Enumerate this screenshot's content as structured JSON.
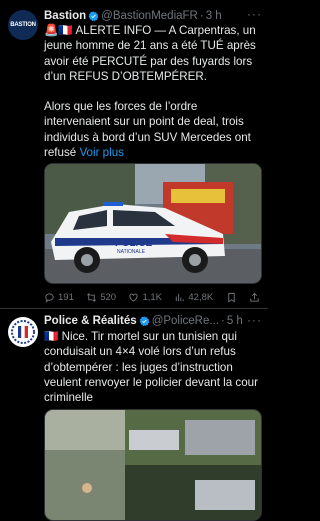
{
  "tweets": [
    {
      "name": "Bastion",
      "handle": "@BastionMediaFR",
      "sep": "·",
      "time": "3 h",
      "avatar_text": "BASTION",
      "headline": "🚨🇫🇷 ALERTE INFO — A Carpentras, un jeune homme de 21 ans a été TUÉ après avoir été PERCUTÉ par des fuyards lors d’un REFUS D’OBTEMPÉRER.",
      "paragraph": "Alors que les forces de l’ordre intervenaient sur un point de deal, trois individus à bord d’un SUV Mercedes ont refusé",
      "see_more": "Voir plus",
      "media_car_text": "POLICE",
      "media_car_subtext": "NATIONALE",
      "actions": {
        "replies": "191",
        "retweets": "520",
        "likes": "1,1K",
        "views": "42,8K"
      }
    },
    {
      "name": "Police & Réalités",
      "handle": "@PoliceRe...",
      "sep": "·",
      "time": "5 h",
      "text": "🇫🇷 Nice. Tir mortel sur un tunisien qui conduisait un 4×4 volé lors d’un refus d’obtempérer : les juges d’instruction veulent renvoyer le policier devant la cour criminelle"
    }
  ],
  "colors": {
    "accent": "#1d9bf0",
    "muted": "#71767b",
    "background": "#000000"
  }
}
